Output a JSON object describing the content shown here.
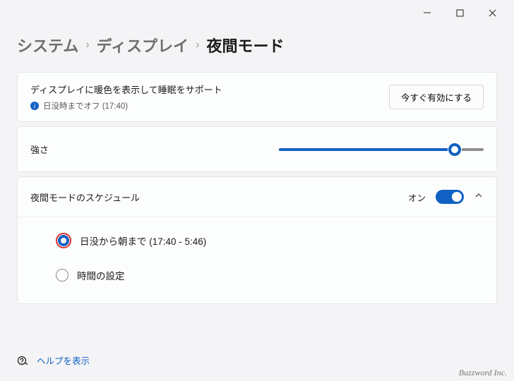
{
  "window": {
    "minimize": "—",
    "maximize": "□",
    "close": "✕"
  },
  "breadcrumb": {
    "level1": "システム",
    "level2": "ディスプレイ",
    "level3": "夜間モード"
  },
  "section1": {
    "title": "ディスプレイに暖色を表示して睡眠をサポート",
    "status": "日没時までオフ (17:40)",
    "button": "今すぐ有効にする"
  },
  "strength": {
    "label": "強さ",
    "value_percent": 86
  },
  "schedule": {
    "label": "夜間モードのスケジュール",
    "toggle_state": "オン",
    "option1": "日没から朝まで (17:40 - 5:46)",
    "option2": "時間の設定",
    "selected": 1
  },
  "help": {
    "label": "ヘルプを表示"
  },
  "watermark": "Buzzword Inc."
}
